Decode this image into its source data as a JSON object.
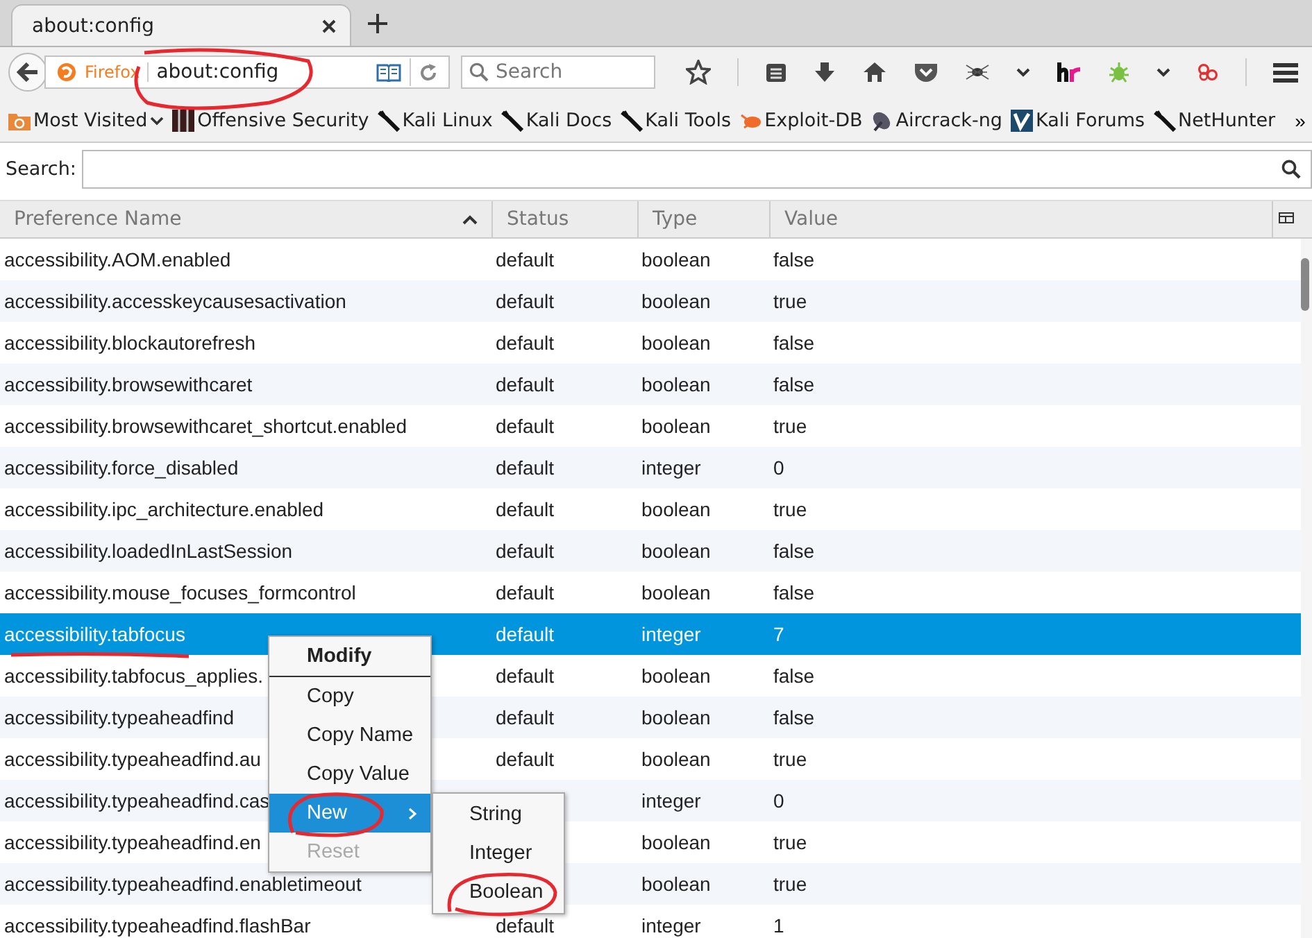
{
  "tabs": [
    {
      "title": "about:config",
      "selected": true
    }
  ],
  "navbar": {
    "identity": "Firefox",
    "url": "about:config",
    "search_placeholder": "Search"
  },
  "bookmarks": [
    {
      "label": "Most Visited",
      "kind": "folder"
    },
    {
      "label": "Offensive Security",
      "kind": "offsec"
    },
    {
      "label": "Kali Linux",
      "kind": "kali"
    },
    {
      "label": "Kali Docs",
      "kind": "kali"
    },
    {
      "label": "Kali Tools",
      "kind": "kali"
    },
    {
      "label": "Exploit-DB",
      "kind": "bug"
    },
    {
      "label": "Aircrack-ng",
      "kind": "dish"
    },
    {
      "label": "Kali Forums",
      "kind": "forum"
    },
    {
      "label": "NetHunter",
      "kind": "kali"
    }
  ],
  "bookmarks_overflow": "»",
  "search_label": "Search:",
  "columns": [
    {
      "label": "Preference Name",
      "sorted": true
    },
    {
      "label": "Status",
      "sorted": false
    },
    {
      "label": "Type",
      "sorted": false
    },
    {
      "label": "Value",
      "sorted": false
    }
  ],
  "rows": [
    {
      "name": "accessibility.AOM.enabled",
      "status": "default",
      "type": "boolean",
      "value": "false",
      "selected": false
    },
    {
      "name": "accessibility.accesskeycausesactivation",
      "status": "default",
      "type": "boolean",
      "value": "true",
      "selected": false
    },
    {
      "name": "accessibility.blockautorefresh",
      "status": "default",
      "type": "boolean",
      "value": "false",
      "selected": false
    },
    {
      "name": "accessibility.browsewithcaret",
      "status": "default",
      "type": "boolean",
      "value": "false",
      "selected": false
    },
    {
      "name": "accessibility.browsewithcaret_shortcut.enabled",
      "status": "default",
      "type": "boolean",
      "value": "true",
      "selected": false
    },
    {
      "name": "accessibility.force_disabled",
      "status": "default",
      "type": "integer",
      "value": "0",
      "selected": false
    },
    {
      "name": "accessibility.ipc_architecture.enabled",
      "status": "default",
      "type": "boolean",
      "value": "true",
      "selected": false
    },
    {
      "name": "accessibility.loadedInLastSession",
      "status": "default",
      "type": "boolean",
      "value": "false",
      "selected": false
    },
    {
      "name": "accessibility.mouse_focuses_formcontrol",
      "status": "default",
      "type": "boolean",
      "value": "false",
      "selected": false
    },
    {
      "name": "accessibility.tabfocus",
      "status": "default",
      "type": "integer",
      "value": "7",
      "selected": true
    },
    {
      "name": "accessibility.tabfocus_applies.",
      "status": "default",
      "type": "boolean",
      "value": "false",
      "selected": false
    },
    {
      "name": "accessibility.typeaheadfind",
      "status": "default",
      "type": "boolean",
      "value": "false",
      "selected": false
    },
    {
      "name": "accessibility.typeaheadfind.au",
      "status": "default",
      "type": "boolean",
      "value": "true",
      "selected": false
    },
    {
      "name": "accessibility.typeaheadfind.cas",
      "type": "integer",
      "value": "0",
      "selected": false
    },
    {
      "name": "accessibility.typeaheadfind.en",
      "type": "boolean",
      "value": "true",
      "selected": false
    },
    {
      "name": "accessibility.typeaheadfind.enabletimeout",
      "type": "boolean",
      "value": "true",
      "selected": false
    },
    {
      "name": "accessibility.typeaheadfind.flashBar",
      "status": "default",
      "type": "integer",
      "value": "1",
      "selected": false
    }
  ],
  "context_menu": [
    {
      "label": "Modify",
      "kind": "item",
      "bold": true,
      "disabled": false,
      "selected": false,
      "submenu": false
    },
    {
      "kind": "separator"
    },
    {
      "label": "Copy",
      "kind": "item",
      "bold": false,
      "disabled": false,
      "selected": false,
      "submenu": false
    },
    {
      "label": "Copy Name",
      "kind": "item",
      "bold": false,
      "disabled": false,
      "selected": false,
      "submenu": false
    },
    {
      "label": "Copy Value",
      "kind": "item",
      "bold": false,
      "disabled": false,
      "selected": false,
      "submenu": false
    },
    {
      "label": "New",
      "kind": "item",
      "bold": false,
      "disabled": false,
      "selected": true,
      "submenu": true
    },
    {
      "label": "Reset",
      "kind": "item",
      "bold": false,
      "disabled": true,
      "selected": false,
      "submenu": false
    }
  ],
  "submenu": [
    {
      "label": "String",
      "selected": false
    },
    {
      "label": "Integer",
      "selected": false
    },
    {
      "label": "Boolean",
      "selected": false
    }
  ]
}
